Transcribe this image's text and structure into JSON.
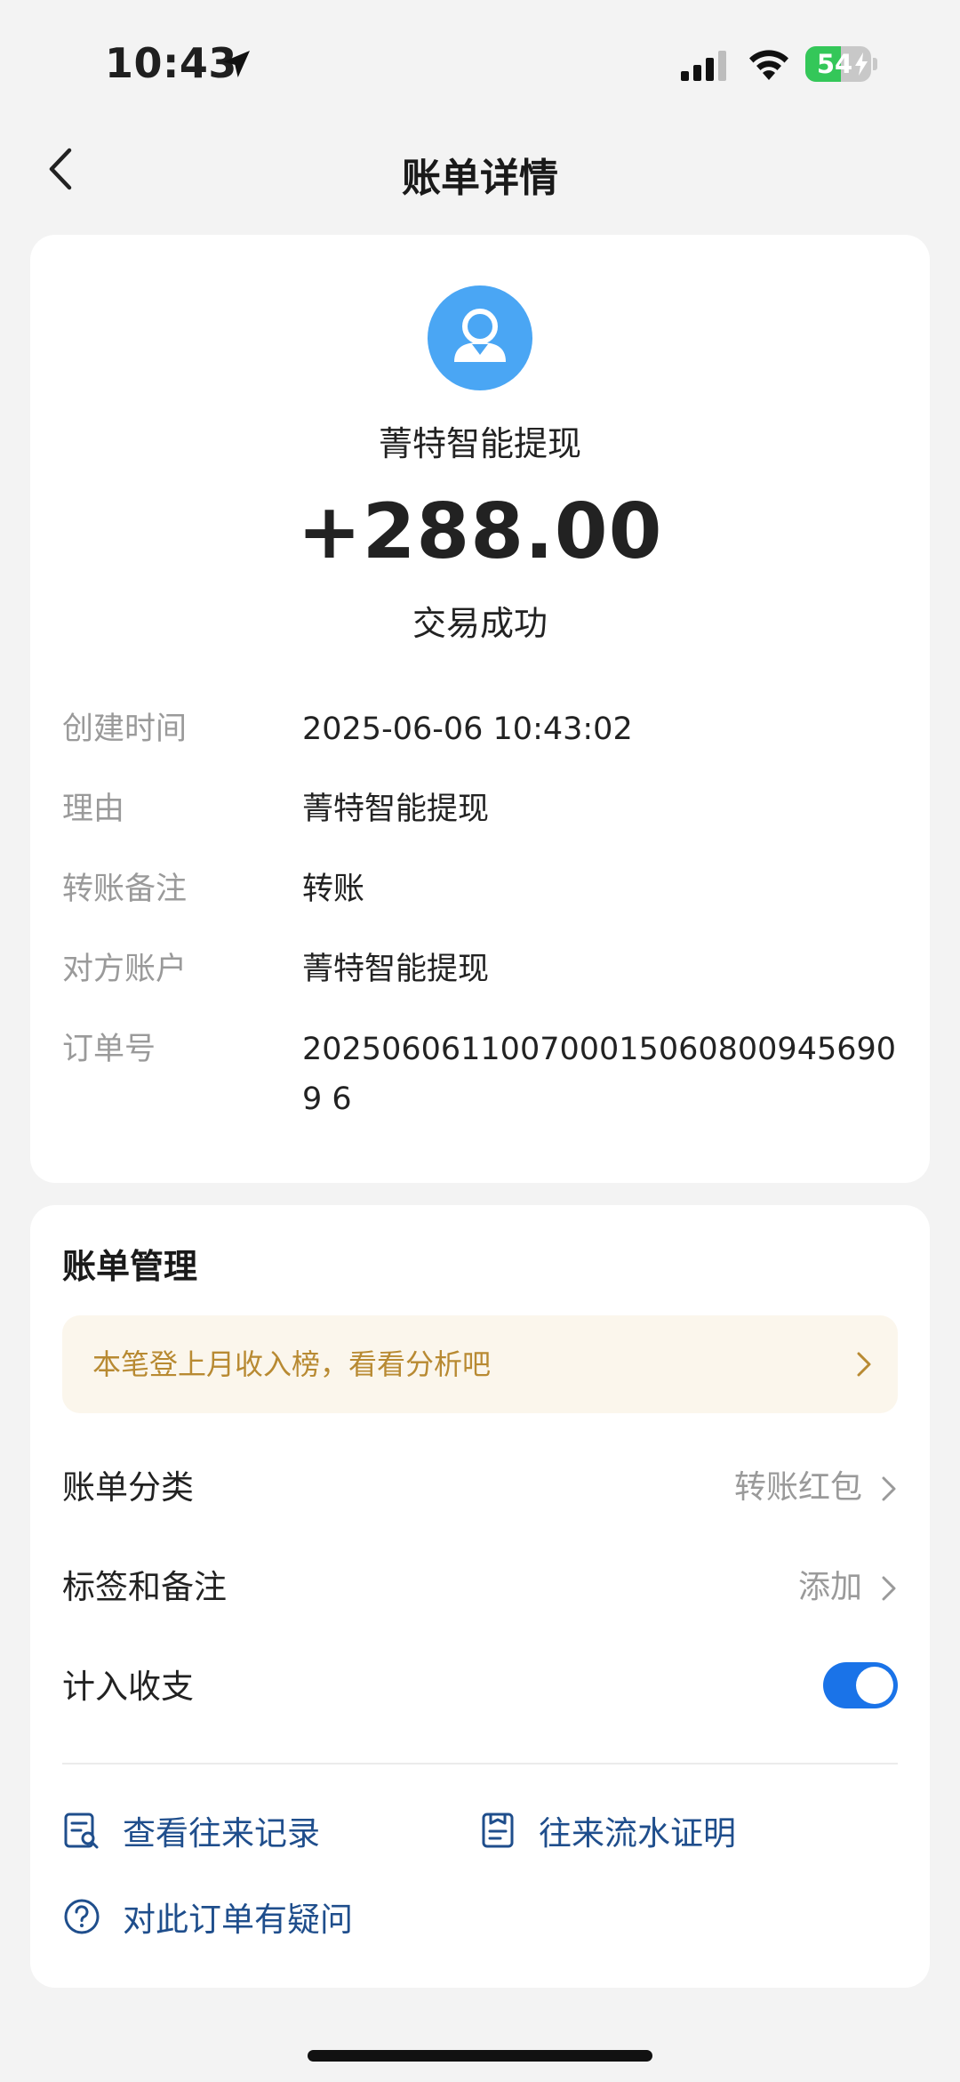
{
  "status_bar": {
    "time": "10:43",
    "battery_level": "54",
    "battery_fraction": 0.54,
    "colors": {
      "battery": "#34c759"
    },
    "icons": [
      "location-arrow-icon",
      "cellular-signal-icon",
      "wifi-icon",
      "battery-charging-icon"
    ]
  },
  "nav": {
    "title": "账单详情",
    "back_icon": "chevron-left-icon"
  },
  "transaction": {
    "avatar_icon": "user-avatar-icon",
    "payee": "菁特智能提现",
    "amount": "+288.00",
    "status": "交易成功"
  },
  "details": [
    {
      "label": "创建时间",
      "value": "2025-06-06 10:43:02"
    },
    {
      "label": "理由",
      "value": "菁特智能提现"
    },
    {
      "label": "转账备注",
      "value": "转账"
    },
    {
      "label": "对方账户",
      "value": "菁特智能提现"
    },
    {
      "label": "订单号",
      "value": "2025060611007000150608009456909 6"
    }
  ],
  "management": {
    "title": "账单管理",
    "banner": "本笔登上月收入榜，看看分析吧",
    "category": {
      "label": "账单分类",
      "value": "转账红包"
    },
    "tags": {
      "label": "标签和备注",
      "value": "添加"
    },
    "include": {
      "label": "计入收支",
      "on": true
    },
    "actions": [
      {
        "label": "查看往来记录",
        "icon": "record-search-icon"
      },
      {
        "label": "往来流水证明",
        "icon": "certificate-icon"
      },
      {
        "label": "对此订单有疑问",
        "icon": "question-circle-icon"
      }
    ],
    "colors": {
      "accent": "#1a73e8",
      "link": "#1f4e8c",
      "banner_text": "#b88a32",
      "banner_bg": "#fbf6ec"
    }
  }
}
